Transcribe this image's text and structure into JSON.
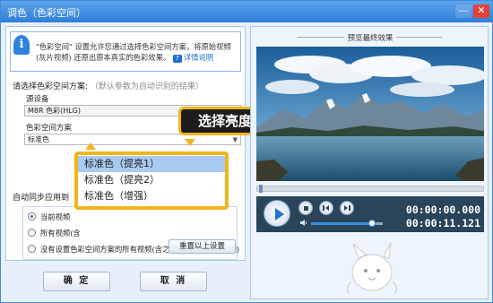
{
  "window": {
    "title": "调色（色彩空间）",
    "min_glyph": "—",
    "close_glyph": "✕"
  },
  "info": {
    "line1": "\"色彩空间\" 设置允许您通过选择色彩空间方案，将原始视频",
    "line2": "(灰片视频) 还原出原本真实的色彩效果。",
    "help_label": "详情说明",
    "help_icon": "?",
    "icon_glyph": "i"
  },
  "color_space": {
    "section_label": "请选择色彩空间方案:",
    "section_hint": "（默认参数为自动识别的结果）",
    "source_device_label": "源设备",
    "source_device_value": "M8R 色彩(HLG)",
    "scheme_label": "色彩空间方案",
    "scheme_value": "标准色"
  },
  "dropdown": {
    "items": [
      "标准色（提亮1）",
      "标准色（提亮2）",
      "标准色（增强）"
    ],
    "selected_index": 0
  },
  "tooltip": {
    "text": "选择亮度级别"
  },
  "apply": {
    "section_label": "自动同步应用到",
    "options": [
      {
        "label": "当前视频",
        "checked": true
      },
      {
        "label": "所有视频(含",
        "checked": false
      },
      {
        "label": "没有设置色彩空间方案的所有视频(含之前导入过的所有视频)",
        "checked": false
      }
    ],
    "reset_label": "重置以上设置"
  },
  "buttons": {
    "ok": "确 定",
    "cancel": "取 消"
  },
  "preview": {
    "title": "预览最终效果",
    "time_current": "00:00:00.000",
    "time_total": "00:00:11.121",
    "seek_chevron": "⌄",
    "volume_level": 0.85
  },
  "colors": {
    "accent": "#f0b51c",
    "title_bar": "#2f7ed9",
    "selection": "#a9cbf2"
  },
  "icons": [
    "info-icon",
    "help-icon",
    "play-icon",
    "stop-icon",
    "prev-icon",
    "next-icon",
    "volume-icon",
    "minimize-icon",
    "close-icon"
  ]
}
